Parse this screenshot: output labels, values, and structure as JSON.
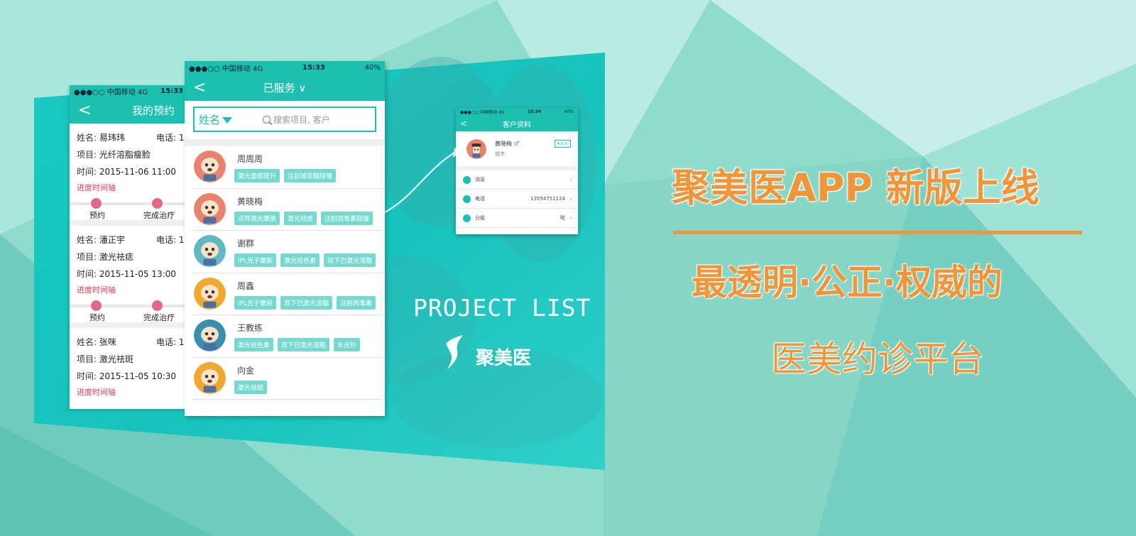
{
  "appointment_screen": {
    "status": {
      "carrier": "●●●○○ 中国移动  4G",
      "time": "15:33"
    },
    "title": "我的预约",
    "back": "<",
    "cards": [
      {
        "name_label": "姓名:",
        "name": "易玮玮",
        "phone_label": "电话: 1",
        "item_label": "项目:",
        "item": "光纤溶脂瘦脸",
        "time_label": "时间:",
        "time": "2015-11-06 11:00",
        "timeline_title": "进度时间轴",
        "step1": "预约",
        "step2": "完成治疗"
      },
      {
        "name_label": "姓名:",
        "name": "潘正宇",
        "phone_label": "电话: 1",
        "item_label": "项目:",
        "item": "激光祛痣",
        "time_label": "时间:",
        "time": "2015-11-05 13:00",
        "timeline_title": "进度时间轴",
        "step1": "预约",
        "step2": "完成治疗"
      },
      {
        "name_label": "姓名:",
        "name": "张咪",
        "phone_label": "电话: 1",
        "item_label": "项目:",
        "item": "激光祛斑",
        "time_label": "时间:",
        "time": "2015-11-05 10:30",
        "timeline_title": "进度时间轴"
      }
    ]
  },
  "served_screen": {
    "status": {
      "carrier": "●●●○○ 中国移动  4G",
      "time": "15:33",
      "battery": "40%"
    },
    "title": "已服务 ∨",
    "back": "<",
    "search": {
      "field": "姓名",
      "placeholder": "搜索项目, 客户"
    },
    "clients": [
      {
        "name": "周周周",
        "tags": [
          "激光面部提升",
          "注射玻尿酸除皱"
        ],
        "avatar_color": "#e8836f"
      },
      {
        "name": "黄晓梅",
        "tags": [
          "点阵激光嫩肤",
          "激光祛痣",
          "注射肉毒素除皱"
        ],
        "avatar_color": "#e8836f"
      },
      {
        "name": "谢群",
        "tags": [
          "IPL光子嫩肤",
          "激光祛色素",
          "双下巴激光溶脂"
        ],
        "avatar_color": "#5fb8c4"
      },
      {
        "name": "周鑫",
        "tags": [
          "IPL光子嫩肤",
          "双下巴激光溶脂",
          "注射肉毒素"
        ],
        "avatar_color": "#f0a830"
      },
      {
        "name": "王教练",
        "tags": [
          "激光祛色素",
          "双下巴激光溶脂",
          "水光针"
        ],
        "avatar_color": "#3a8fb0"
      },
      {
        "name": "向金",
        "tags": [
          "激光祛斑"
        ],
        "avatar_color": "#f0a830"
      }
    ]
  },
  "profile_screen": {
    "status": {
      "carrier": "●●●○○ 中国移动  4G",
      "time": "15:34",
      "battery": "40%"
    },
    "title": "客户资料",
    "back": "<",
    "name": "黄晓梅",
    "gender": "♂",
    "city_label": "城市:",
    "badge": "未关注!",
    "rows": [
      {
        "label": "消息",
        "value": ""
      },
      {
        "label": "电话",
        "value": "13554751124"
      },
      {
        "label": "分组",
        "value": "啦"
      }
    ]
  },
  "poster": {
    "project_list": "PROJECT LIST",
    "brand": "聚美医"
  },
  "headline": {
    "title": "聚美医APP 新版上线",
    "line1": "最透明·公正·权威的",
    "line2": "医美约诊平台"
  },
  "colors": {
    "accent": "#1bc0b0",
    "headline": "#f0963a",
    "timeline_dot": "#e06a84"
  }
}
